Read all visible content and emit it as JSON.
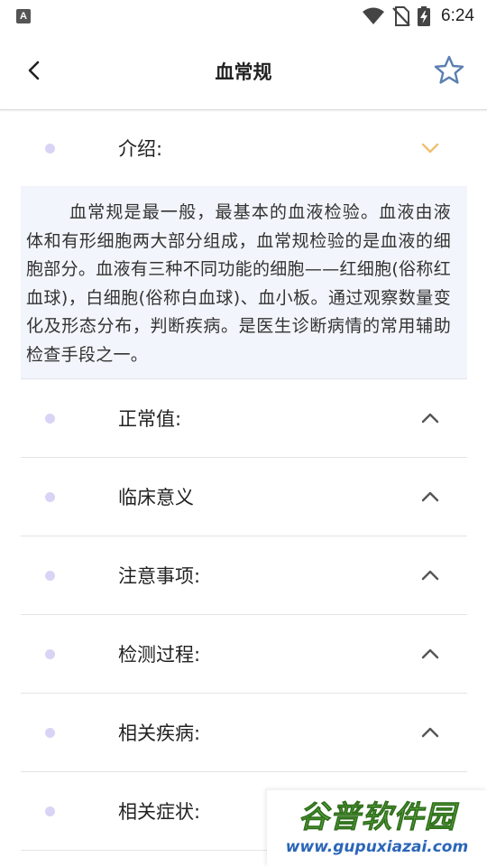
{
  "status_bar": {
    "notification_letter": "A",
    "time": "6:24"
  },
  "app_bar": {
    "title": "血常规"
  },
  "sections": [
    {
      "label": "介绍:",
      "expanded": true
    },
    {
      "label": "正常值:",
      "expanded": false
    },
    {
      "label": "临床意义",
      "expanded": false
    },
    {
      "label": "注意事项:",
      "expanded": false
    },
    {
      "label": "检测过程:",
      "expanded": false
    },
    {
      "label": "相关疾病:",
      "expanded": false
    },
    {
      "label": "相关症状:",
      "expanded": false
    }
  ],
  "intro_text": "血常规是最一般，最基本的血液检验。血液由液体和有形细胞两大部分组成，血常规检验的是血液的细胞部分。血液有三种不同功能的细胞——红细胞(俗称红血球)，白细胞(俗称白血球)、血小板。通过观察数量变化及形态分布，判断疾病。是医生诊断病情的常用辅助检查手段之一。",
  "watermark": {
    "title": "谷普软件园",
    "url": "www.gupuxiazai.com"
  },
  "colors": {
    "dot": "#d9d4f5",
    "chevron_expanded": "#f0c070",
    "chevron_collapsed": "#555555",
    "intro_background": "#f2f5fb",
    "star": "#5a7fb0",
    "watermark_green": "#5aa83a",
    "watermark_blue": "#2b66b8"
  }
}
